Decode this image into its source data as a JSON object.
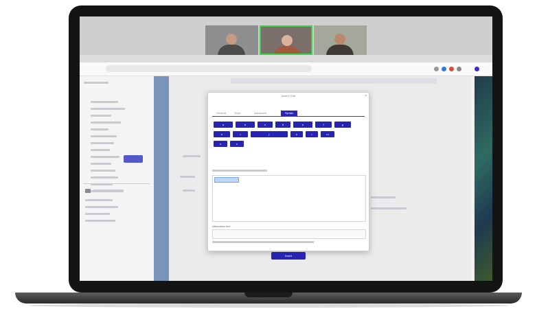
{
  "dialog": {
    "title": "Insert / Edit",
    "close": "×",
    "tabs": [
      {
        "label": "General"
      },
      {
        "label": "Style"
      },
      {
        "label": "Advanced"
      },
      {
        "label": "Syntax"
      }
    ],
    "toolbar_rows": [
      [
        "a",
        "b",
        "c",
        "d",
        "e",
        "f",
        "g"
      ],
      [
        "h",
        "i",
        "j",
        "k",
        "l",
        "m"
      ],
      [
        "n",
        "o"
      ]
    ],
    "field_label": "Alternative text",
    "submit_label": "Insert"
  },
  "colors": {
    "accent": "#2723b3",
    "rail": "#7a93b8",
    "panel_button": "#5359c9"
  }
}
